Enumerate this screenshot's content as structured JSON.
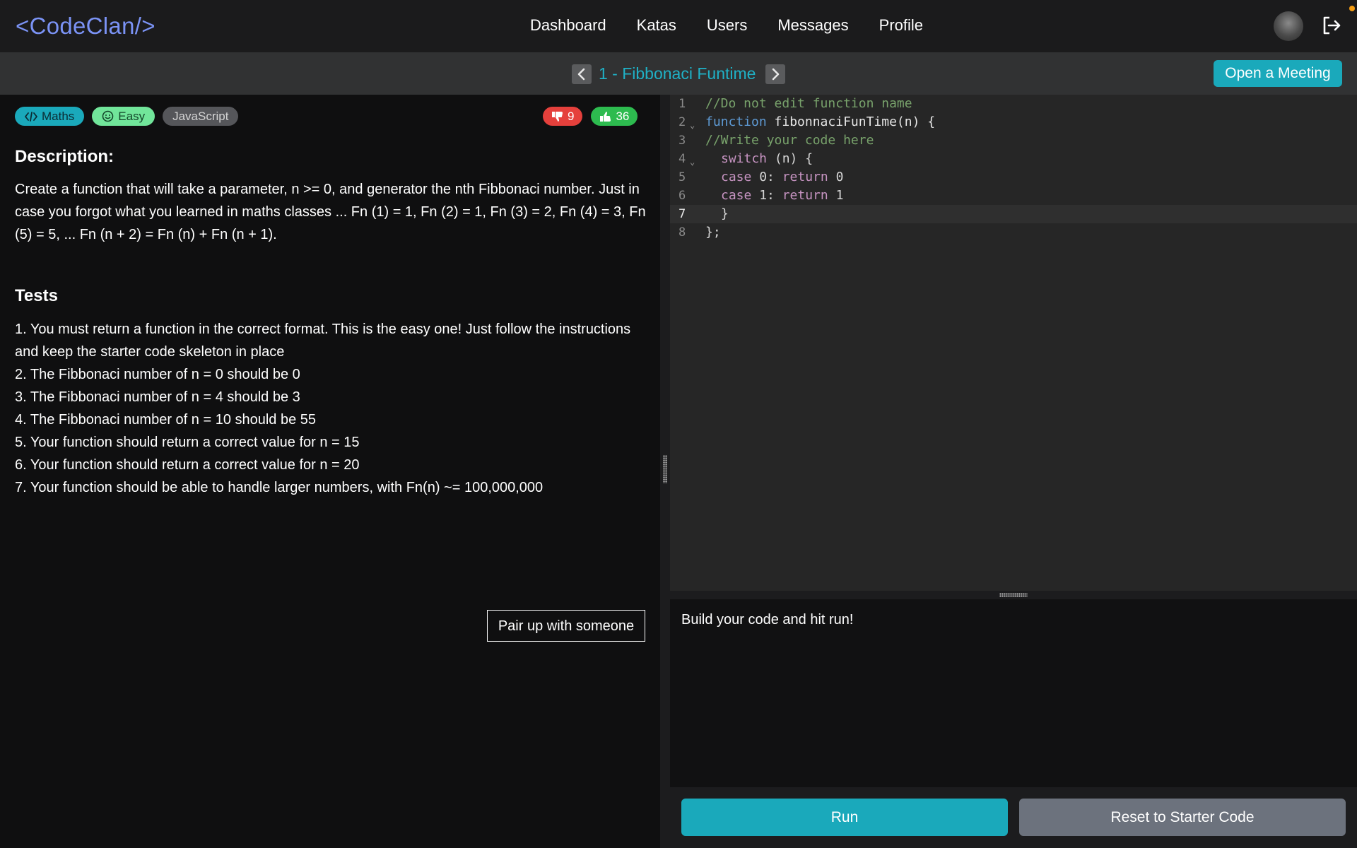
{
  "header": {
    "logo": "<CodeClan/>",
    "nav": [
      "Dashboard",
      "Katas",
      "Users",
      "Messages",
      "Profile"
    ],
    "icons": {
      "avatar": "user-avatar",
      "logout": "logout-icon"
    }
  },
  "kata": {
    "title": "1 - Fibbonaci Funtime",
    "meeting_button": "Open a Meeting",
    "tags": {
      "category": "Maths",
      "difficulty": "Easy",
      "language": "JavaScript"
    },
    "votes": {
      "down": "9",
      "up": "36"
    },
    "description_heading": "Description:",
    "description": "Create a function that will take a parameter, n >= 0, and generator the nth Fibbonaci number. Just in case you forgot what you learned in maths classes ... Fn (1) = 1, Fn (2) = 1, Fn (3) = 2, Fn (4) = 3, Fn (5) = 5, ... Fn (n + 2) = Fn (n) + Fn (n + 1).",
    "tests_heading": "Tests",
    "tests": [
      "1. You must return a function in the correct format. This is the easy one! Just follow the instructions and keep the starter code skeleton in place",
      "2. The Fibbonaci number of n = 0 should be 0",
      "3. The Fibbonaci number of n = 4 should be 3",
      "4. The Fibbonaci number of n = 10 should be 55",
      "5. Your function should return a correct value for n = 15",
      "6. Your function should return a correct value for n = 20",
      "7. Your function should be able to handle larger numbers, with Fn(n) ~= 100,000,000"
    ],
    "pair_button": "Pair up with someone"
  },
  "editor": {
    "line_numbers": [
      "1",
      "2",
      "3",
      "4",
      "5",
      "6",
      "7",
      "8"
    ],
    "active_line": "7",
    "lines": {
      "l1_comment": "//Do not edit function name",
      "l2_kw": "function",
      "l2_rest": " fibonnaciFunTime(n) {",
      "l3_comment": "//Write your code here",
      "l4_kw": "switch",
      "l4_rest": " (n) {",
      "l5_kw": "case",
      "l5_mid": " 0: ",
      "l5_kw2": "return",
      "l5_rest": " 0",
      "l6_kw": "case",
      "l6_mid": " 1: ",
      "l6_kw2": "return",
      "l6_rest": " 1",
      "l7": "}",
      "l8": "};"
    }
  },
  "output": {
    "message": "Build your code and hit run!"
  },
  "actions": {
    "run": "Run",
    "reset": "Reset to Starter Code"
  },
  "colors": {
    "accent": "#1aa9bb",
    "logo": "#7b93f5",
    "easy": "#71e59a",
    "downvote": "#e5403c",
    "upvote": "#2dbb4f"
  }
}
